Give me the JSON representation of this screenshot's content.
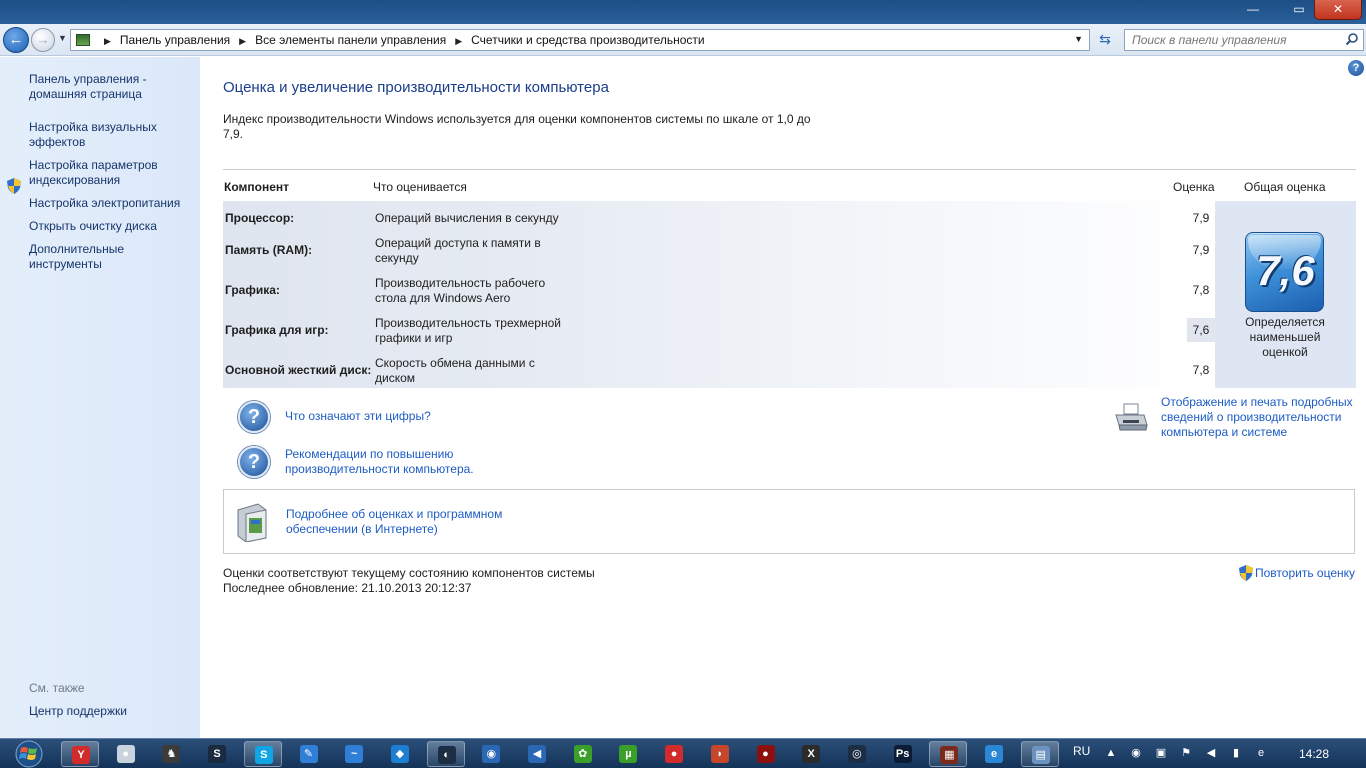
{
  "window": {
    "minimize": "—",
    "maximize": "▭",
    "close": "✕"
  },
  "nav": {
    "back_glyph": "←",
    "forward_glyph": "→",
    "breadcrumbs": [
      "Панель управления",
      "Все элементы панели управления",
      "Счетчики и средства производительности"
    ],
    "search_placeholder": "Поиск в панели управления"
  },
  "sidebar": {
    "items": [
      {
        "label": "Панель управления - домашняя страница",
        "icon": ""
      },
      {
        "label": "Настройка визуальных эффектов",
        "icon": "shield-icon"
      },
      {
        "label": "Настройка параметров индексирования",
        "icon": ""
      },
      {
        "label": "Настройка электропитания",
        "icon": ""
      },
      {
        "label": "Открыть очистку диска",
        "icon": ""
      },
      {
        "label": "Дополнительные инструменты",
        "icon": ""
      }
    ],
    "see_also": "См. также",
    "support_center": "Центр поддержки"
  },
  "main": {
    "help_glyph": "?",
    "title": "Оценка и увеличение производительности компьютера",
    "intro": "Индекс производительности Windows используется для оценки компонентов системы по шкале от 1,0 до 7,9.",
    "table": {
      "headers": {
        "component": "Компонент",
        "what": "Что оценивается",
        "score": "Оценка",
        "base": "Общая оценка"
      },
      "rows": [
        {
          "component": "Процессор:",
          "what": "Операций вычисления в секунду",
          "score": "7,9"
        },
        {
          "component": "Память (RAM):",
          "what": "Операций доступа к памяти в секунду",
          "score": "7,9"
        },
        {
          "component": "Графика:",
          "what": "Производительность рабочего стола для Windows Aero",
          "score": "7,8"
        },
        {
          "component": "Графика для игр:",
          "what": "Производительность трехмерной графики и игр",
          "score": "7,6"
        },
        {
          "component": "Основной жесткий диск:",
          "what": "Скорость обмена данными с диском",
          "score": "7,8"
        }
      ],
      "base_score": "7,6",
      "base_caption": "Определяется наименьшей оценкой"
    },
    "links": {
      "what_numbers": "Что означают эти цифры?",
      "tips": "Рекомендации по повышению производительности компьютера.",
      "print_details": "Отображение и печать подробных сведений о производительности компьютера и системе",
      "learn_more": "Подробнее об оценках и программном обеспечении (в Интернете)"
    },
    "status": {
      "current": "Оценки соответствуют текущему состоянию компонентов системы",
      "last_update": "Последнее обновление: 21.10.2013 20:12:37"
    },
    "rerun": "Повторить оценку"
  },
  "taskbar": {
    "items": [
      {
        "name": "yandex-browser",
        "glyph": "Y",
        "color": "#d22b2b",
        "active": true
      },
      {
        "name": "app-2",
        "glyph": "●",
        "color": "#c9d3dd",
        "active": false
      },
      {
        "name": "app-3",
        "glyph": "♞",
        "color": "#3b3b3b",
        "active": false
      },
      {
        "name": "steam",
        "glyph": "S",
        "color": "#1a2a3f",
        "active": false
      },
      {
        "name": "skype",
        "glyph": "S",
        "color": "#12a5e6",
        "active": true
      },
      {
        "name": "app-6",
        "glyph": "✎",
        "color": "#2f7fd6",
        "active": false
      },
      {
        "name": "app-7",
        "glyph": "~",
        "color": "#2f7fd6",
        "active": false
      },
      {
        "name": "app-8",
        "glyph": "◆",
        "color": "#1c7fd1",
        "active": false
      },
      {
        "name": "app-9",
        "glyph": "◐",
        "color": "#1c2e44",
        "active": true
      },
      {
        "name": "app-10",
        "glyph": "◉",
        "color": "#2a67b5",
        "active": false
      },
      {
        "name": "app-11",
        "glyph": "◀",
        "color": "#2a67b5",
        "active": false
      },
      {
        "name": "icq",
        "glyph": "✿",
        "color": "#3c9f2a",
        "active": false
      },
      {
        "name": "utorrent",
        "glyph": "µ",
        "color": "#3c9f2a",
        "active": false
      },
      {
        "name": "app-14",
        "glyph": "●",
        "color": "#d22b2b",
        "active": false
      },
      {
        "name": "app-15",
        "glyph": "◗",
        "color": "#c7472c",
        "active": false
      },
      {
        "name": "app-16",
        "glyph": "●",
        "color": "#8c1010",
        "active": false
      },
      {
        "name": "app-17",
        "glyph": "X",
        "color": "#2b2b2b",
        "active": false
      },
      {
        "name": "app-18",
        "glyph": "◎",
        "color": "#1c2e44",
        "active": false
      },
      {
        "name": "photoshop",
        "glyph": "Ps",
        "color": "#0c1c34",
        "active": false
      },
      {
        "name": "app-20",
        "glyph": "▦",
        "color": "#7a2a1a",
        "active": true
      },
      {
        "name": "internet-explorer",
        "glyph": "e",
        "color": "#2a87d6",
        "active": false
      },
      {
        "name": "control-panel",
        "glyph": "▤",
        "color": "#6c93bf",
        "active": true
      }
    ],
    "lang": "RU",
    "tray": [
      "▲",
      "◉",
      "▣",
      "⚑",
      "◀",
      "▮",
      "e"
    ],
    "clock": "14:28"
  }
}
